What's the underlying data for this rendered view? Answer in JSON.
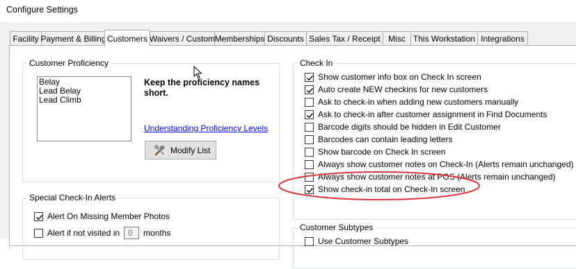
{
  "window": {
    "title": "Configure Settings"
  },
  "tabs": [
    {
      "label": "Facility"
    },
    {
      "label": "Payment & Billing"
    },
    {
      "label": "Customers"
    },
    {
      "label": "Waivers / Custom"
    },
    {
      "label": "Memberships"
    },
    {
      "label": "Discounts"
    },
    {
      "label": "Sales Tax / Receipt"
    },
    {
      "label": "Misc"
    },
    {
      "label": "This Workstation"
    },
    {
      "label": "Integrations"
    }
  ],
  "active_tab": "Customers",
  "proficiency": {
    "title": "Customer Proficiency",
    "items": [
      "Belay",
      "Lead Belay",
      "Lead Climb"
    ],
    "hint": "Keep the proficiency names short.",
    "link": "Understanding Proficiency Levels",
    "modify_button": "Modify List",
    "modify_icon": "tools-icon"
  },
  "special_alerts": {
    "title": "Special Check-In Alerts",
    "options": [
      {
        "label": "Alert On Missing Member Photos",
        "checked": true
      },
      {
        "label": "Alert if not visited in",
        "checked": false
      }
    ],
    "months_value": "0",
    "months_label": "months"
  },
  "checkin": {
    "title": "Check In",
    "options": [
      {
        "label": "Show customer info box on Check In screen",
        "checked": true
      },
      {
        "label": "Auto create NEW checkins for new customers",
        "checked": true
      },
      {
        "label": "Ask to check-in when adding new customers manually",
        "checked": false
      },
      {
        "label": "Ask to check-in after customer assignment in Find Documents",
        "checked": true
      },
      {
        "label": "Barcode digits should be hidden in Edit Customer",
        "checked": false
      },
      {
        "label": "Barcodes can contain leading letters",
        "checked": false
      },
      {
        "label": "Show barcode on Check In screen",
        "checked": false
      },
      {
        "label": "Always show customer notes on Check-In (Alerts remain unchanged)",
        "checked": false
      },
      {
        "label": "Always show customer notes at POS (Alerts remain unchanged)",
        "checked": false
      },
      {
        "label": "Show check-in total on Check-In screen",
        "checked": true
      }
    ]
  },
  "subtypes": {
    "title": "Customer Subtypes",
    "options": [
      {
        "label": "Use Customer Subtypes",
        "checked": false
      }
    ]
  },
  "colors": {
    "annotation": "#d9343a",
    "link": "#0000ff",
    "check": "#000000"
  }
}
